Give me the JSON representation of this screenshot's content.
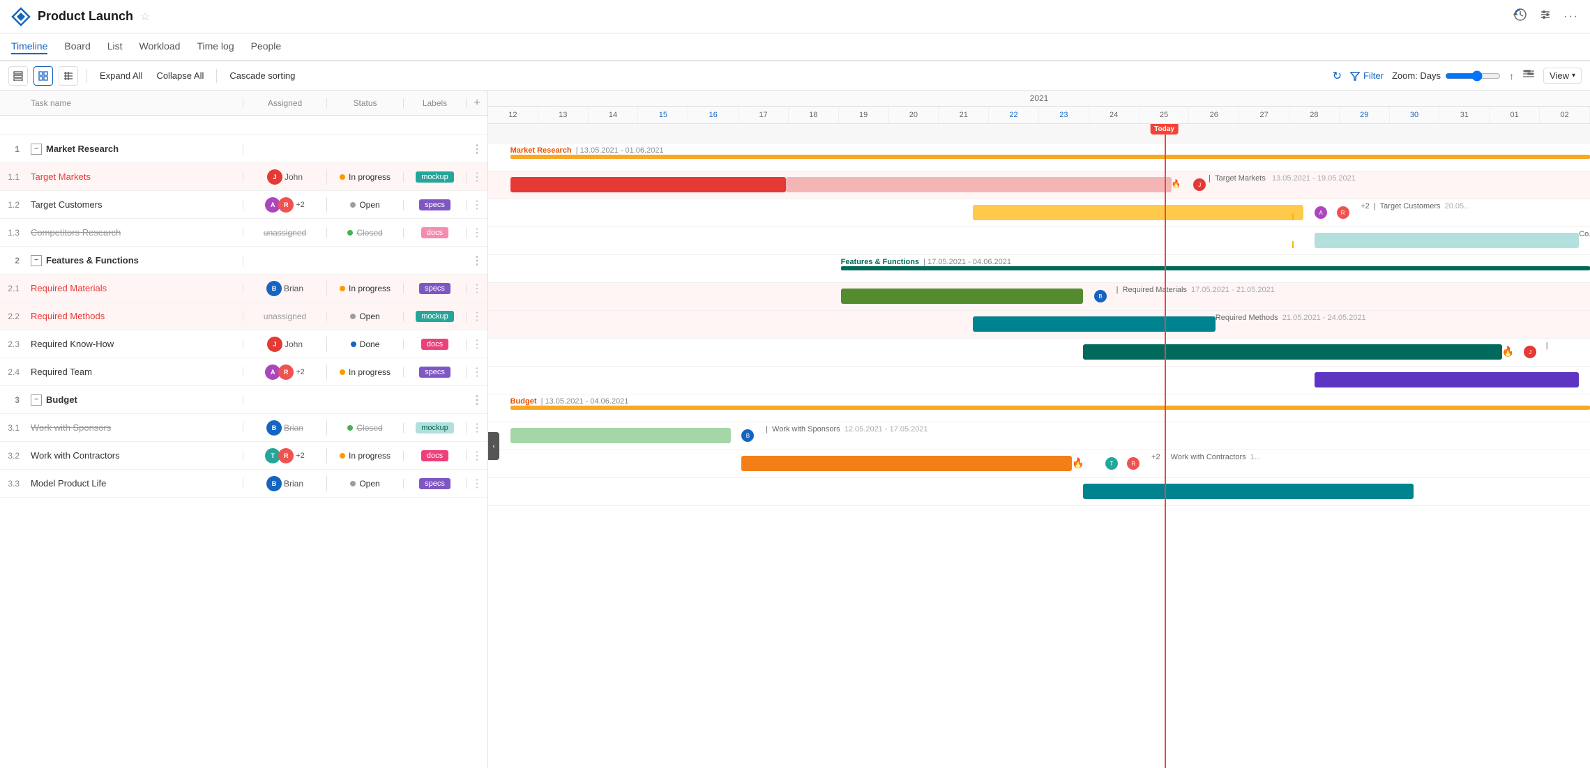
{
  "app": {
    "title": "Product Launch",
    "logo_symbol": "◇"
  },
  "header": {
    "history_icon": "⟳",
    "settings_icon": "⚙",
    "more_icon": "···"
  },
  "nav": {
    "tabs": [
      {
        "label": "Timeline",
        "active": true
      },
      {
        "label": "Board",
        "active": false
      },
      {
        "label": "List",
        "active": false
      },
      {
        "label": "Workload",
        "active": false
      },
      {
        "label": "Time log",
        "active": false
      },
      {
        "label": "People",
        "active": false
      }
    ]
  },
  "toolbar": {
    "expand_all": "Expand All",
    "collapse_all": "Collapse All",
    "cascade_sorting": "Cascade sorting",
    "filter_label": "Filter",
    "zoom_label": "Zoom: Days",
    "view_label": "View"
  },
  "task_columns": {
    "name": "Task name",
    "assigned": "Assigned",
    "status": "Status",
    "labels": "Labels"
  },
  "gantt": {
    "year": "2021",
    "days": [
      "12",
      "13",
      "14",
      "15",
      "16",
      "17",
      "18",
      "19",
      "20",
      "21",
      "22",
      "23",
      "24",
      "25",
      "26",
      "27",
      "28",
      "29",
      "30",
      "31",
      "01",
      "02"
    ],
    "today": "Today",
    "today_day": "25"
  },
  "tasks": [
    {
      "id": "",
      "num": "",
      "indent": 0,
      "type": "spacer",
      "name": "",
      "assigned": "",
      "status": "",
      "label": "",
      "highlight": false,
      "strikethrough": false
    },
    {
      "id": "1",
      "num": "1",
      "indent": 0,
      "type": "group",
      "name": "Market Research",
      "assigned": "",
      "status": "",
      "label": "",
      "highlight": false,
      "strikethrough": false
    },
    {
      "id": "1.1",
      "num": "1.1",
      "indent": 1,
      "type": "task",
      "name": "Target Markets",
      "assigned": "John",
      "assigned_avatar_color": "#e53935",
      "status": "In progress",
      "status_color": "#ff9800",
      "label": "mockup",
      "label_type": "mockup",
      "highlight": true,
      "strikethrough": false,
      "name_color": "red"
    },
    {
      "id": "1.2",
      "num": "1.2",
      "indent": 1,
      "type": "task",
      "name": "Target Customers",
      "assigned": "+2",
      "assigned_avatar_colors": [
        "#ab47bc",
        "#ef5350"
      ],
      "status": "Open",
      "status_color": "#9e9e9e",
      "label": "specs",
      "label_type": "specs",
      "highlight": false,
      "strikethrough": false,
      "name_color": "normal"
    },
    {
      "id": "1.3",
      "num": "1.3",
      "indent": 1,
      "type": "task",
      "name": "Competitors Research",
      "assigned": "unassigned",
      "status": "Closed",
      "status_color": "#4caf50",
      "label": "docs",
      "label_type": "docs",
      "highlight": false,
      "strikethrough": true,
      "name_color": "normal"
    },
    {
      "id": "2",
      "num": "2",
      "indent": 0,
      "type": "group",
      "name": "Features & Functions",
      "assigned": "",
      "status": "",
      "label": "",
      "highlight": false,
      "strikethrough": false
    },
    {
      "id": "2.1",
      "num": "2.1",
      "indent": 1,
      "type": "task",
      "name": "Required Materials",
      "assigned": "Brian",
      "assigned_avatar_color": "#1565c0",
      "status": "In progress",
      "status_color": "#ff9800",
      "label": "specs",
      "label_type": "specs",
      "highlight": true,
      "strikethrough": false,
      "name_color": "red"
    },
    {
      "id": "2.2",
      "num": "2.2",
      "indent": 1,
      "type": "task",
      "name": "Required Methods",
      "assigned": "unassigned",
      "status": "Open",
      "status_color": "#9e9e9e",
      "label": "mockup",
      "label_type": "mockup",
      "highlight": true,
      "strikethrough": false,
      "name_color": "red"
    },
    {
      "id": "2.3",
      "num": "2.3",
      "indent": 1,
      "type": "task",
      "name": "Required Know-How",
      "assigned": "John",
      "assigned_avatar_color": "#e53935",
      "status": "Done",
      "status_color": "#1565c0",
      "label": "docs",
      "label_type": "docs",
      "highlight": false,
      "strikethrough": false,
      "name_color": "normal"
    },
    {
      "id": "2.4",
      "num": "2.4",
      "indent": 1,
      "type": "task",
      "name": "Required Team",
      "assigned": "+2",
      "assigned_avatar_colors": [
        "#ab47bc",
        "#ef5350"
      ],
      "status": "In progress",
      "status_color": "#ff9800",
      "label": "specs",
      "label_type": "specs",
      "highlight": false,
      "strikethrough": false,
      "name_color": "normal"
    },
    {
      "id": "3",
      "num": "3",
      "indent": 0,
      "type": "group",
      "name": "Budget",
      "assigned": "",
      "status": "",
      "label": "",
      "highlight": false,
      "strikethrough": false
    },
    {
      "id": "3.1",
      "num": "3.1",
      "indent": 1,
      "type": "task",
      "name": "Work with Sponsors",
      "assigned": "Brian",
      "assigned_avatar_color": "#1565c0",
      "status": "Closed",
      "status_color": "#4caf50",
      "label": "mockup",
      "label_type": "mockup-light",
      "highlight": false,
      "strikethrough": true,
      "name_color": "normal"
    },
    {
      "id": "3.2",
      "num": "3.2",
      "indent": 1,
      "type": "task",
      "name": "Work with Contractors",
      "assigned": "+2",
      "assigned_avatar_colors": [
        "#26a69a",
        "#ef5350"
      ],
      "status": "In progress",
      "status_color": "#ff9800",
      "label": "docs",
      "label_type": "docs",
      "highlight": false,
      "strikethrough": false,
      "name_color": "normal"
    },
    {
      "id": "3.3",
      "num": "3.3",
      "indent": 1,
      "type": "task",
      "name": "Model Product Life",
      "assigned": "Brian",
      "assigned_avatar_color": "#1565c0",
      "status": "Open",
      "status_color": "#9e9e9e",
      "label": "specs",
      "label_type": "specs",
      "highlight": false,
      "strikethrough": false,
      "name_color": "normal"
    }
  ]
}
